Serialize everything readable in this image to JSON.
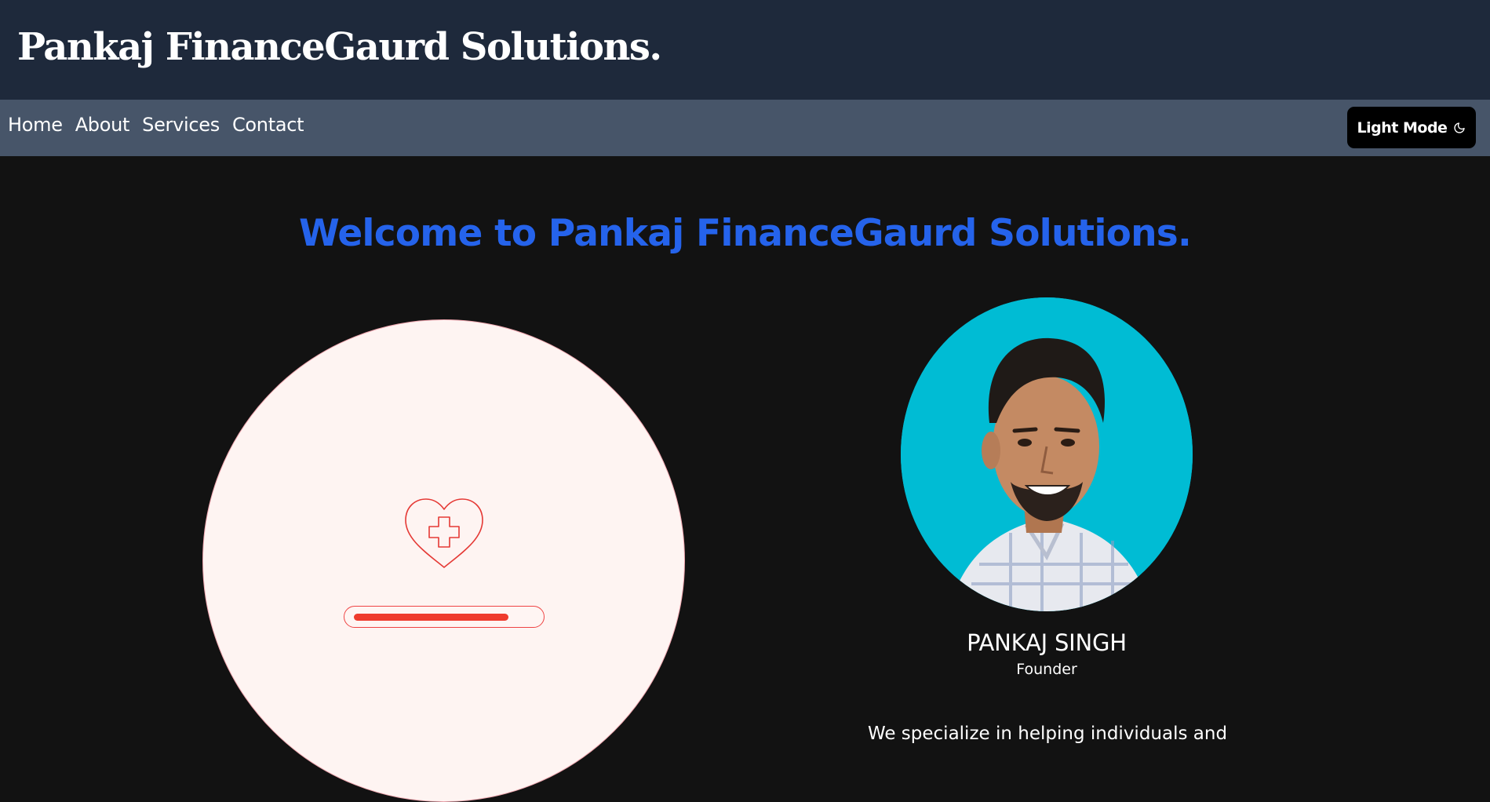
{
  "header": {
    "brand": "Pankaj FinanceGaurd Solutions."
  },
  "nav": {
    "links": [
      "Home",
      "About",
      "Services",
      "Contact"
    ],
    "theme_toggle_label": "Light Mode",
    "theme_toggle_icon": "moon-icon"
  },
  "hero": {
    "heading": "Welcome to Pankaj FinanceGaurd Solutions.",
    "heading_color": "#2563eb",
    "illustration_icon": "heart-plus-icon",
    "loading_progress": 0.85
  },
  "founder": {
    "photo": "founder-photo",
    "name": "PANKAJ SINGH",
    "role": "Founder",
    "intro": "We specialize in helping individuals and"
  },
  "colors": {
    "header_bg": "#1e293b",
    "navbar_bg": "#475569",
    "page_bg": "#121212",
    "accent_red": "#ef3b2d",
    "photo_bg": "#00bcd4"
  }
}
